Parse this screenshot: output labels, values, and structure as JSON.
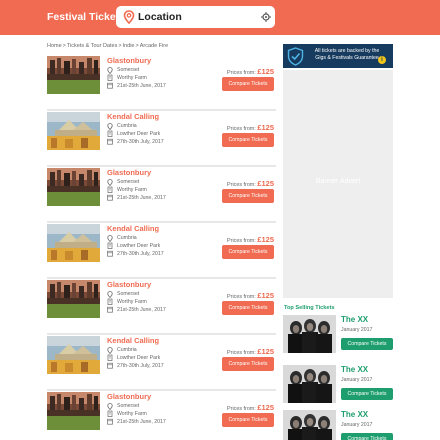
{
  "header": {
    "title": "Festival Tickets:",
    "search_value": "Location"
  },
  "breadcrumb": [
    "Home",
    "Tickets & Tour Dates",
    "Indie",
    "Arcade Fire"
  ],
  "listings": [
    {
      "name": "Glastonbury",
      "region": "Somerset",
      "venue": "Worthy Farm",
      "dates": "21st-25th June, 2017",
      "price_label": "Prices from:",
      "price": "£125",
      "button": "Compare Tickets",
      "image": "glastonbury"
    },
    {
      "name": "Kendal Calling",
      "region": "Cumbria",
      "venue": "Lowther Deer Park",
      "dates": "27th-30th July, 2017",
      "price_label": "Prices from:",
      "price": "£125",
      "button": "Compare Tickets",
      "image": "kendal"
    },
    {
      "name": "Glastonbury",
      "region": "Somerset",
      "venue": "Worthy Farm",
      "dates": "21st-25th June, 2017",
      "price_label": "Prices from:",
      "price": "£125",
      "button": "Compare Tickets",
      "image": "glastonbury"
    },
    {
      "name": "Kendal Calling",
      "region": "Cumbria",
      "venue": "Lowther Deer Park",
      "dates": "27th-30th July, 2017",
      "price_label": "Prices from:",
      "price": "£125",
      "button": "Compare Tickets",
      "image": "kendal"
    },
    {
      "name": "Glastonbury",
      "region": "Somerset",
      "venue": "Worthy Farm",
      "dates": "21st-25th June, 2017",
      "price_label": "Prices from:",
      "price": "£125",
      "button": "Compare Tickets",
      "image": "glastonbury"
    },
    {
      "name": "Kendal Calling",
      "region": "Cumbria",
      "venue": "Lowther Deer Park",
      "dates": "27th-30th July, 2017",
      "price_label": "Prices from:",
      "price": "£125",
      "button": "Compare Tickets",
      "image": "kendal"
    },
    {
      "name": "Glastonbury",
      "region": "Somerset",
      "venue": "Worthy Farm",
      "dates": "21st-25th June, 2017",
      "price_label": "Prices from:",
      "price": "£125",
      "button": "Compare Tickets",
      "image": "glastonbury"
    }
  ],
  "guarantee": {
    "text": "All tickets are backed by the Gigs & Festivals Guarantee",
    "info": "i"
  },
  "banner": {
    "text": "Banner Advert"
  },
  "top_selling": {
    "title": "Top Selling Tickets",
    "items": [
      {
        "name": "The XX",
        "date": "January 2017",
        "button": "Compare Tickets"
      },
      {
        "name": "The XX",
        "date": "January 2017",
        "button": "Compare Tickets"
      },
      {
        "name": "The XX",
        "date": "January 2017",
        "button": "Compare Tickets"
      }
    ]
  },
  "colors": {
    "brand": "#f06b51",
    "accent_green": "#1e9e6e",
    "guarantee_bg": "#163b5e"
  },
  "icons": {
    "search": "location-pin-icon",
    "locate": "crosshair-icon",
    "region": "location-pin-icon",
    "venue": "building-icon",
    "dates": "calendar-icon",
    "guarantee": "shield-check-icon",
    "info": "info-icon"
  }
}
